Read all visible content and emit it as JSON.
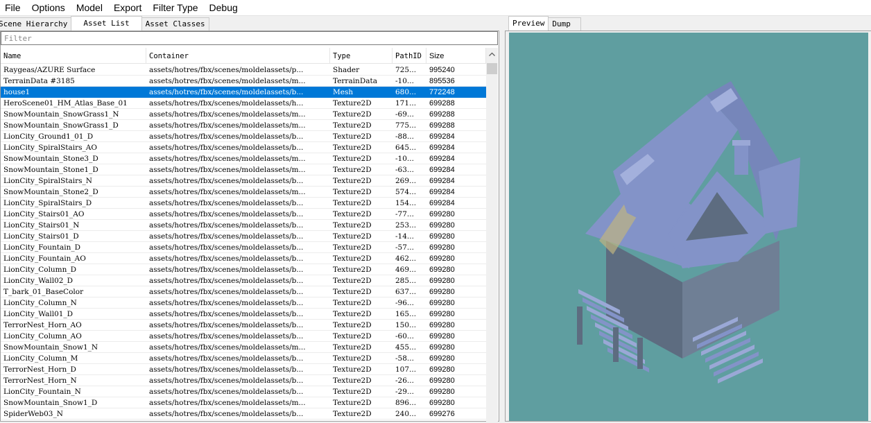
{
  "menu": [
    "File",
    "Options",
    "Model",
    "Export",
    "Filter Type",
    "Debug"
  ],
  "left_tabs": [
    "Scene Hierarchy",
    "Asset List",
    "Asset Classes"
  ],
  "left_active_tab": 1,
  "filter": {
    "placeholder": "Filter",
    "value": ""
  },
  "columns": [
    "Name",
    "Container",
    "Type",
    "PathID",
    "Size"
  ],
  "selected_row": 2,
  "rows": [
    [
      "Raygeas/AZURE Surface",
      "assets/hotres/fbx/scenes/moldelassets/p...",
      "Shader",
      "725...",
      "995240"
    ],
    [
      "TerrainData #3185",
      "assets/hotres/fbx/scenes/moldelassets/m...",
      "TerrainData",
      "-10...",
      "895536"
    ],
    [
      "house1",
      "assets/hotres/fbx/scenes/moldelassets/b...",
      "Mesh",
      "680...",
      "772248"
    ],
    [
      "HeroScene01_HM_Atlas_Base_01",
      "assets/hotres/fbx/scenes/moldelassets/h...",
      "Texture2D",
      "171...",
      "699288"
    ],
    [
      "SnowMountain_SnowGrass1_N",
      "assets/hotres/fbx/scenes/moldelassets/m...",
      "Texture2D",
      "-69...",
      "699288"
    ],
    [
      "SnowMountain_SnowGrass1_D",
      "assets/hotres/fbx/scenes/moldelassets/m...",
      "Texture2D",
      "775...",
      "699288"
    ],
    [
      "LionCity_Ground1_01_D",
      "assets/hotres/fbx/scenes/moldelassets/b...",
      "Texture2D",
      "-88...",
      "699284"
    ],
    [
      "LionCity_SpiralStairs_AO",
      "assets/hotres/fbx/scenes/moldelassets/b...",
      "Texture2D",
      "645...",
      "699284"
    ],
    [
      "SnowMountain_Stone3_D",
      "assets/hotres/fbx/scenes/moldelassets/m...",
      "Texture2D",
      "-10...",
      "699284"
    ],
    [
      "SnowMountain_Stone1_D",
      "assets/hotres/fbx/scenes/moldelassets/m...",
      "Texture2D",
      "-63...",
      "699284"
    ],
    [
      "LionCity_SpiralStairs_N",
      "assets/hotres/fbx/scenes/moldelassets/b...",
      "Texture2D",
      "269...",
      "699284"
    ],
    [
      "SnowMountain_Stone2_D",
      "assets/hotres/fbx/scenes/moldelassets/m...",
      "Texture2D",
      "574...",
      "699284"
    ],
    [
      "LionCity_SpiralStairs_D",
      "assets/hotres/fbx/scenes/moldelassets/b...",
      "Texture2D",
      "154...",
      "699284"
    ],
    [
      "LionCity_Stairs01_AO",
      "assets/hotres/fbx/scenes/moldelassets/b...",
      "Texture2D",
      "-77...",
      "699280"
    ],
    [
      "LionCity_Stairs01_N",
      "assets/hotres/fbx/scenes/moldelassets/b...",
      "Texture2D",
      "253...",
      "699280"
    ],
    [
      "LionCity_Stairs01_D",
      "assets/hotres/fbx/scenes/moldelassets/b...",
      "Texture2D",
      "-14...",
      "699280"
    ],
    [
      "LionCity_Fountain_D",
      "assets/hotres/fbx/scenes/moldelassets/b...",
      "Texture2D",
      "-57...",
      "699280"
    ],
    [
      "LionCity_Fountain_AO",
      "assets/hotres/fbx/scenes/moldelassets/b...",
      "Texture2D",
      "462...",
      "699280"
    ],
    [
      "LionCity_Column_D",
      "assets/hotres/fbx/scenes/moldelassets/b...",
      "Texture2D",
      "469...",
      "699280"
    ],
    [
      "LionCity_Wall02_D",
      "assets/hotres/fbx/scenes/moldelassets/b...",
      "Texture2D",
      "285...",
      "699280"
    ],
    [
      "T_bark_01_BaseColor",
      "assets/hotres/fbx/scenes/moldelassets/b...",
      "Texture2D",
      "637...",
      "699280"
    ],
    [
      "LionCity_Column_N",
      "assets/hotres/fbx/scenes/moldelassets/b...",
      "Texture2D",
      "-96...",
      "699280"
    ],
    [
      "LionCity_Wall01_D",
      "assets/hotres/fbx/scenes/moldelassets/b...",
      "Texture2D",
      "165...",
      "699280"
    ],
    [
      "TerrorNest_Horn_AO",
      "assets/hotres/fbx/scenes/moldelassets/b...",
      "Texture2D",
      "150...",
      "699280"
    ],
    [
      "LionCity_Column_AO",
      "assets/hotres/fbx/scenes/moldelassets/b...",
      "Texture2D",
      "-60...",
      "699280"
    ],
    [
      "SnowMountain_Snow1_N",
      "assets/hotres/fbx/scenes/moldelassets/m...",
      "Texture2D",
      "455...",
      "699280"
    ],
    [
      "LionCity_Column_M",
      "assets/hotres/fbx/scenes/moldelassets/b...",
      "Texture2D",
      "-58...",
      "699280"
    ],
    [
      "TerrorNest_Horn_D",
      "assets/hotres/fbx/scenes/moldelassets/b...",
      "Texture2D",
      "107...",
      "699280"
    ],
    [
      "TerrorNest_Horn_N",
      "assets/hotres/fbx/scenes/moldelassets/b...",
      "Texture2D",
      "-26...",
      "699280"
    ],
    [
      "LionCity_Fountain_N",
      "assets/hotres/fbx/scenes/moldelassets/b...",
      "Texture2D",
      "-29...",
      "699280"
    ],
    [
      "SnowMountain_Snow1_D",
      "assets/hotres/fbx/scenes/moldelassets/m...",
      "Texture2D",
      "896...",
      "699280"
    ],
    [
      "SpiderWeb03_N",
      "assets/hotres/fbx/scenes/moldelassets/b...",
      "Texture2D",
      "240...",
      "699276"
    ]
  ],
  "right_tabs": [
    "Preview",
    "Dump"
  ],
  "right_active_tab": 0,
  "preview": {
    "background_color": "#5f9ea0",
    "model_color": "#8393c8",
    "model_shadow_color": "#5d6c80",
    "model_highlight_color": "#bfb380"
  },
  "colors": {
    "selection": "#0078d7"
  }
}
